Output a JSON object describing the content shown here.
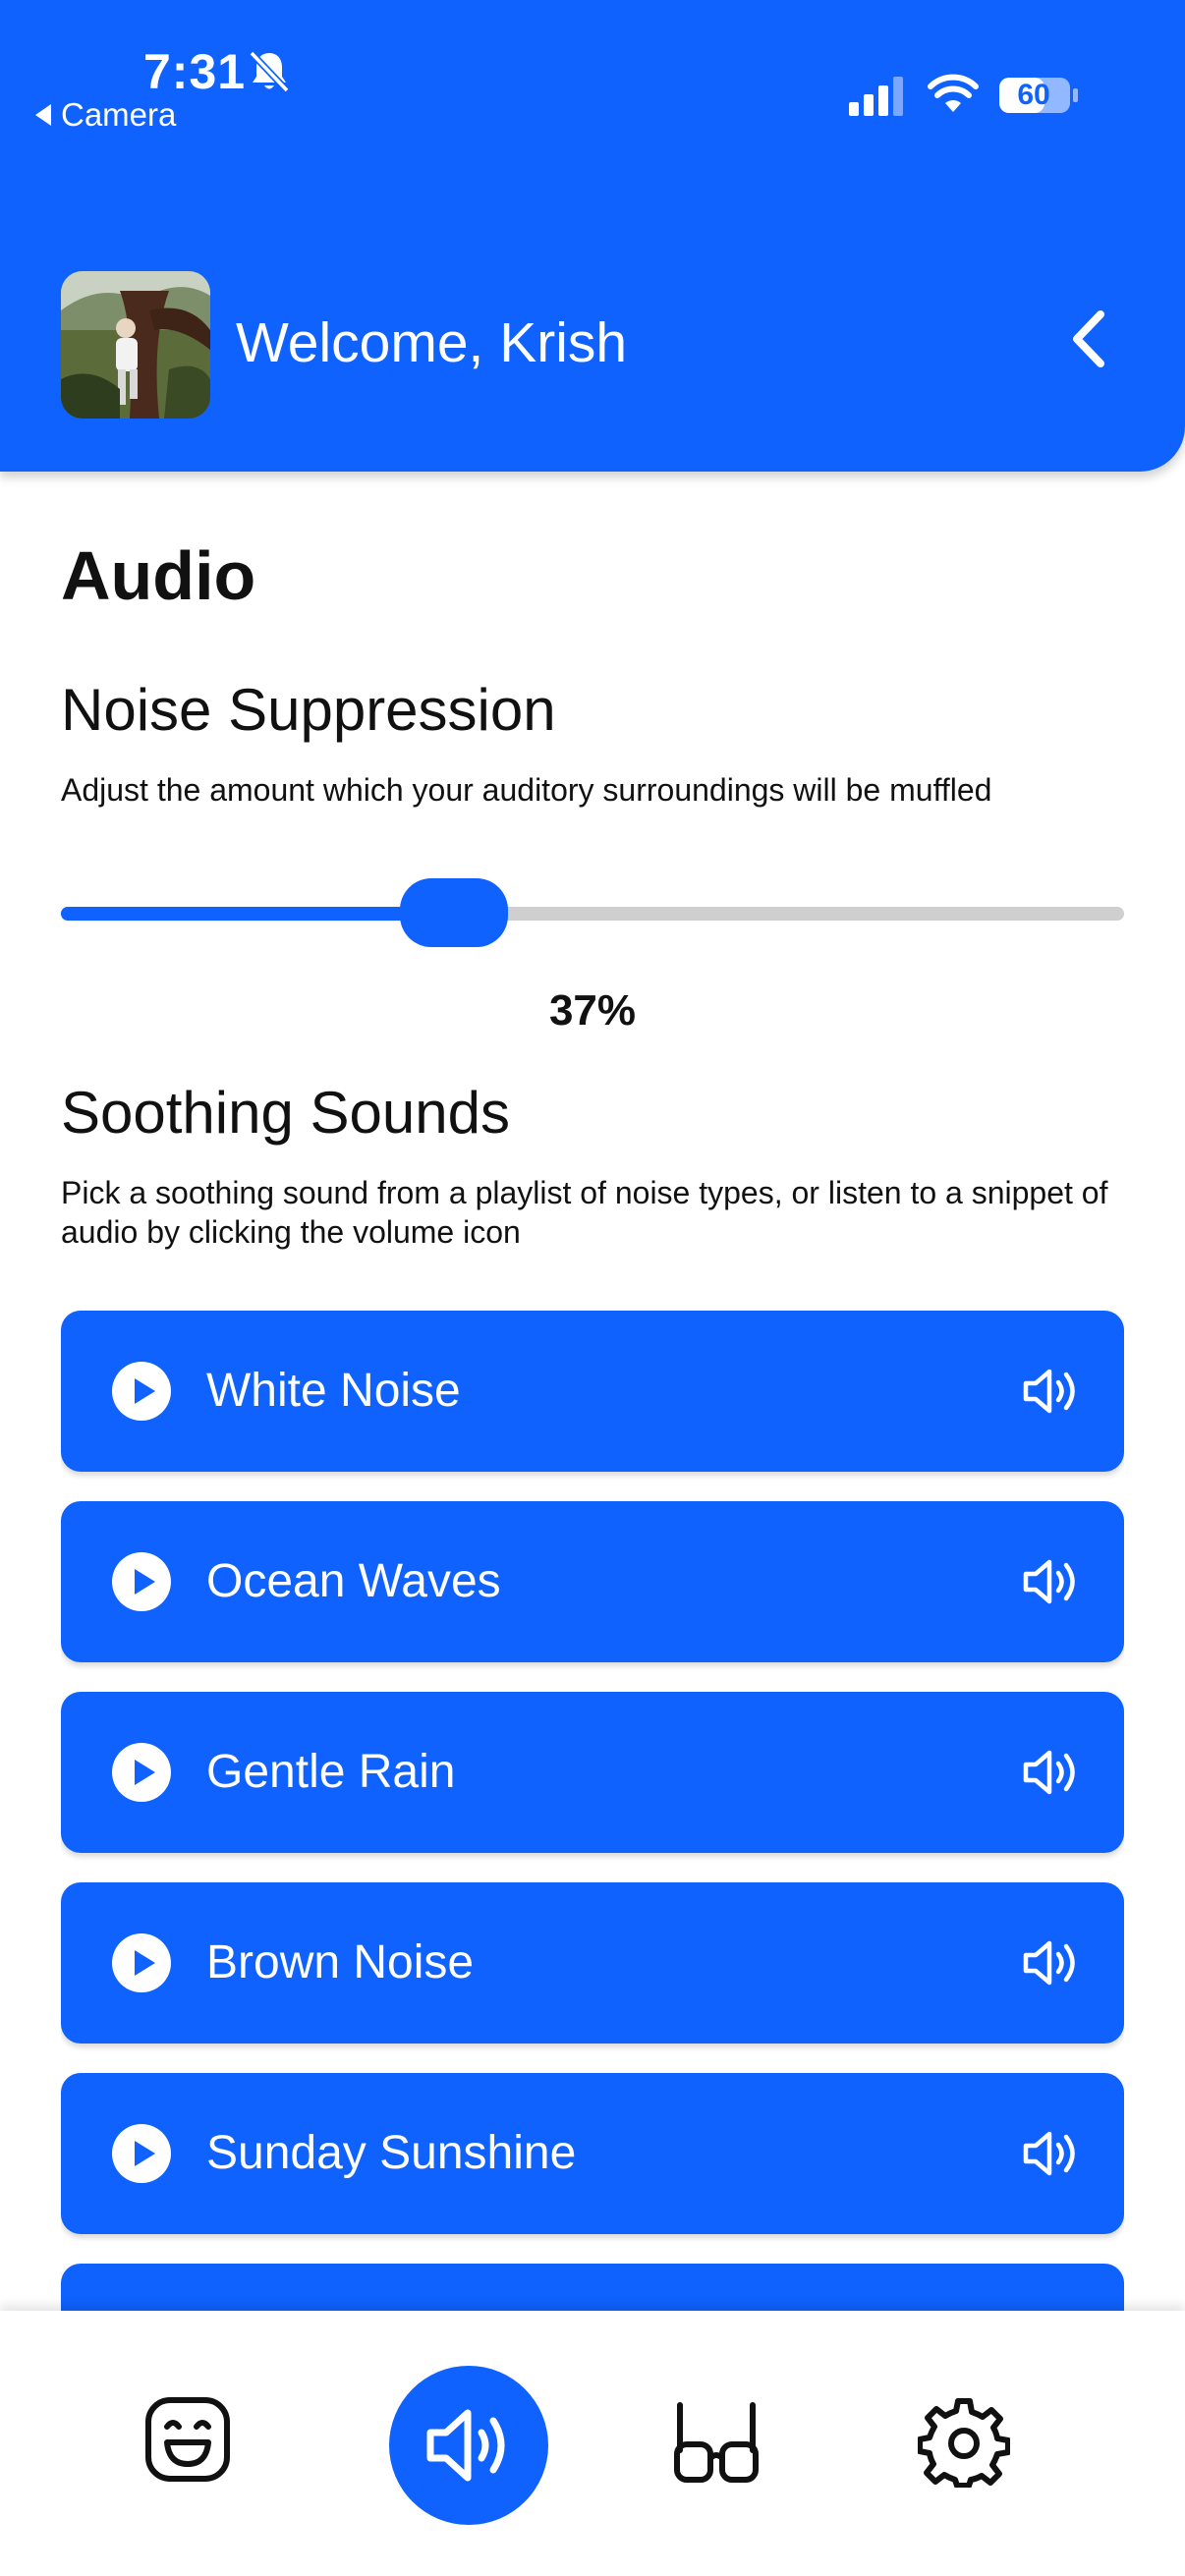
{
  "status_bar": {
    "time": "7:31",
    "back_app": "Camera",
    "battery": "60"
  },
  "header": {
    "welcome": "Welcome, Krish"
  },
  "audio": {
    "title": "Audio",
    "noise_suppression": {
      "title": "Noise Suppression",
      "description": "Adjust the amount which your auditory surroundings will be muffled",
      "value_label": "37%",
      "value_fraction": 0.37
    },
    "soothing_sounds": {
      "title": "Soothing Sounds",
      "description": "Pick a soothing sound from a playlist of noise types, or listen to a snippet of audio by clicking the volume icon",
      "items": [
        {
          "label": "White Noise"
        },
        {
          "label": "Ocean Waves"
        },
        {
          "label": "Gentle Rain"
        },
        {
          "label": "Brown Noise"
        },
        {
          "label": "Sunday Sunshine"
        },
        {
          "label": ""
        }
      ]
    }
  },
  "bottom_nav": {
    "items": [
      {
        "icon": "happy-face-icon",
        "active": false
      },
      {
        "icon": "speaker-icon",
        "active": true
      },
      {
        "icon": "glasses-icon",
        "active": false
      },
      {
        "icon": "gear-icon",
        "active": false
      }
    ]
  },
  "colors": {
    "accent": "#0f62fe",
    "track": "#cfcfcf",
    "text": "#111111"
  }
}
